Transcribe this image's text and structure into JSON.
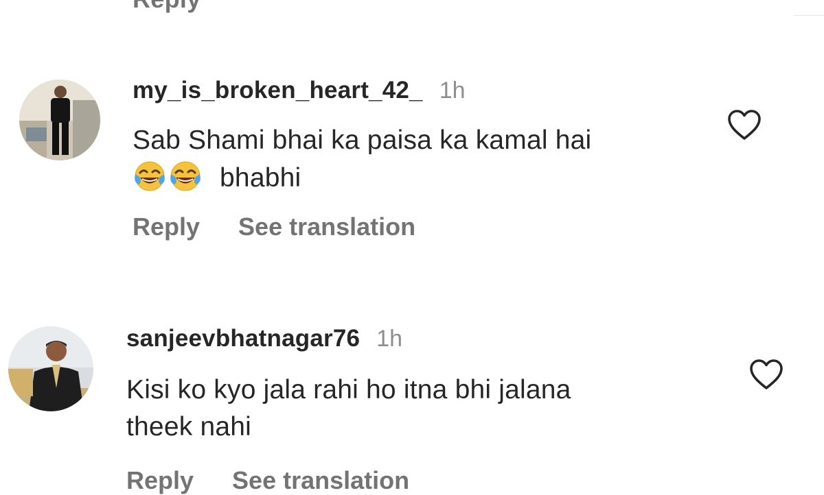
{
  "top": {
    "reply_label": "Reply"
  },
  "comments": [
    {
      "username": "my_is_broken_heart_42_",
      "time": "1h",
      "text_line1": "Sab Shami bhai ka paisa ka kamal hai",
      "emojis": [
        "face-with-tears-of-joy",
        "face-with-tears-of-joy"
      ],
      "text_line2": "bhabhi",
      "reply_label": "Reply",
      "translate_label": "See translation",
      "like_icon": "heart-outline-icon"
    },
    {
      "username": "sanjeevbhatnagar76",
      "time": "1h",
      "text_line1": "Kisi ko kyo jala rahi ho itna bhi jalana",
      "text_line2": "theek nahi",
      "reply_label": "Reply",
      "translate_label": "See translation",
      "like_icon": "heart-outline-icon"
    }
  ]
}
